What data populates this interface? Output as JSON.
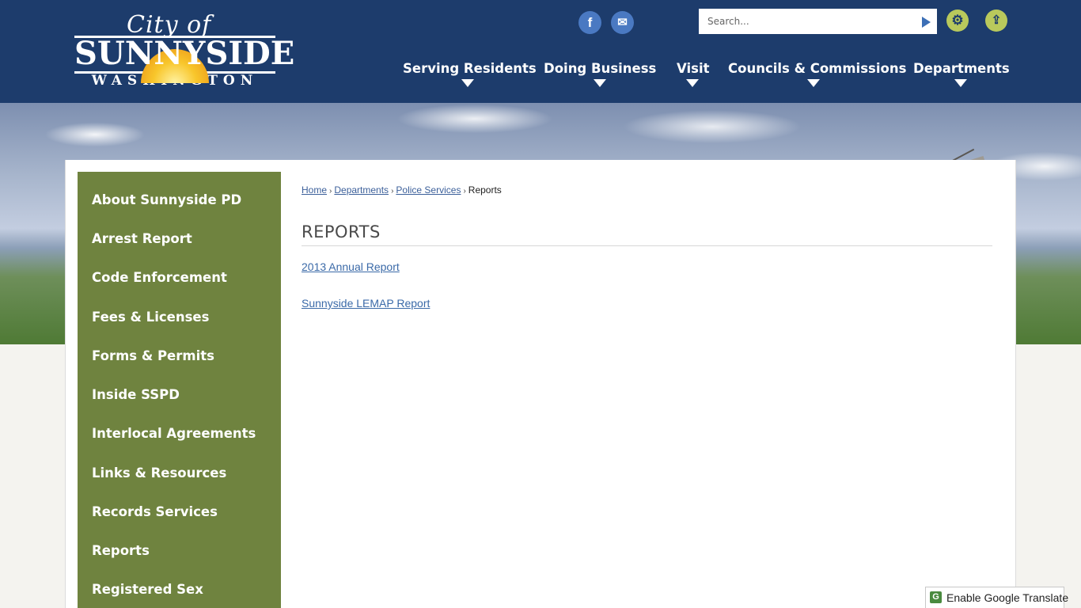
{
  "logo": {
    "top_text": "City of",
    "main_text": "SUNNYSIDE",
    "sub_text": "WASHINGTON"
  },
  "social": {
    "facebook_glyph": "f",
    "notify_glyph": "✉"
  },
  "search": {
    "placeholder": "Search..."
  },
  "tools": {
    "gear_glyph": "⚙",
    "share_glyph": "⇪"
  },
  "nav": {
    "items": [
      {
        "label": "Serving Residents"
      },
      {
        "label": "Doing Business"
      },
      {
        "label": "Visit"
      },
      {
        "label": "Councils & Commissions"
      },
      {
        "label": "Departments"
      }
    ]
  },
  "sidebar": {
    "items": [
      {
        "label": "About Sunnyside PD"
      },
      {
        "label": "Arrest Report"
      },
      {
        "label": "Code Enforcement"
      },
      {
        "label": "Fees & Licenses"
      },
      {
        "label": "Forms & Permits"
      },
      {
        "label": "Inside SSPD"
      },
      {
        "label": "Interlocal Agreements"
      },
      {
        "label": "Links & Resources"
      },
      {
        "label": "Records Services"
      },
      {
        "label": "Reports"
      },
      {
        "label": "Registered Sex"
      }
    ]
  },
  "breadcrumb": {
    "home": "Home",
    "departments": "Departments",
    "police": "Police Services",
    "current": "Reports",
    "separator": "›"
  },
  "page": {
    "title": "REPORTS",
    "links": [
      {
        "label": "2013 Annual Report"
      },
      {
        "label": "Sunnyside LEMAP Report"
      }
    ]
  },
  "translate": {
    "icon_glyph": "G",
    "label": "Enable Google Translate"
  },
  "colors": {
    "header_bg": "#1d3c6c",
    "sidebar_bg": "#6f833f",
    "link": "#3b6aa8",
    "tool_accent": "#b9c95c"
  }
}
